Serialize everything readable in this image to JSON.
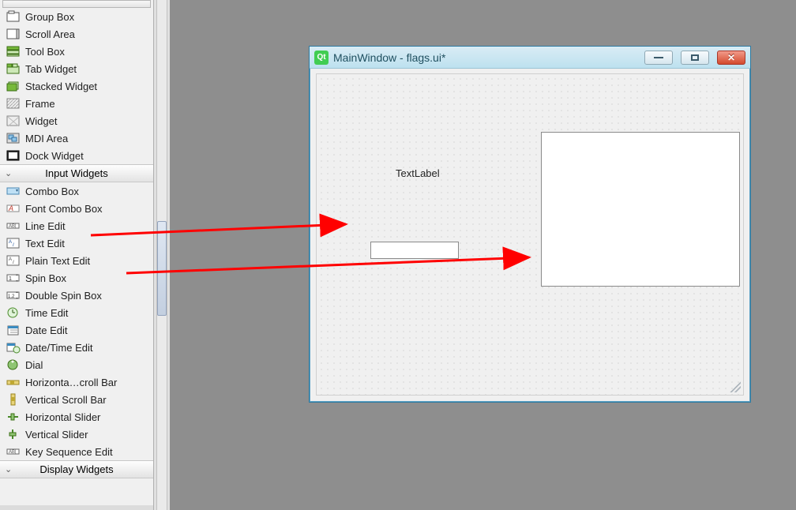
{
  "widget_box": {
    "items_before": [
      {
        "label": "Group Box",
        "icon": "groupbox"
      },
      {
        "label": "Scroll Area",
        "icon": "scrollarea"
      },
      {
        "label": "Tool Box",
        "icon": "toolbox"
      },
      {
        "label": "Tab Widget",
        "icon": "tabwidget"
      },
      {
        "label": "Stacked Widget",
        "icon": "stackedwidget"
      },
      {
        "label": "Frame",
        "icon": "frame"
      },
      {
        "label": "Widget",
        "icon": "widget"
      },
      {
        "label": "MDI Area",
        "icon": "mdiarea"
      },
      {
        "label": "Dock Widget",
        "icon": "dockwidget"
      }
    ],
    "category_input": "Input Widgets",
    "items_input": [
      {
        "label": "Combo Box",
        "icon": "combobox"
      },
      {
        "label": "Font Combo Box",
        "icon": "fontcombobox"
      },
      {
        "label": "Line Edit",
        "icon": "lineedit"
      },
      {
        "label": "Text Edit",
        "icon": "textedit"
      },
      {
        "label": "Plain Text Edit",
        "icon": "plaintextedit"
      },
      {
        "label": "Spin Box",
        "icon": "spinbox"
      },
      {
        "label": "Double Spin Box",
        "icon": "doublespinbox"
      },
      {
        "label": "Time Edit",
        "icon": "timeedit"
      },
      {
        "label": "Date Edit",
        "icon": "dateedit"
      },
      {
        "label": "Date/Time Edit",
        "icon": "datetimeedit"
      },
      {
        "label": "Dial",
        "icon": "dial"
      },
      {
        "label": "Horizonta…croll Bar",
        "icon": "hscrollbar"
      },
      {
        "label": "Vertical Scroll Bar",
        "icon": "vscrollbar"
      },
      {
        "label": "Horizontal Slider",
        "icon": "hslider"
      },
      {
        "label": "Vertical Slider",
        "icon": "vslider"
      },
      {
        "label": "Key Sequence Edit",
        "icon": "keyseq"
      }
    ],
    "category_display": "Display Widgets"
  },
  "designer_window": {
    "title": "MainWindow - flags.ui*",
    "label_text": "TextLabel"
  },
  "annotations": {
    "arrow1_from": "Line Edit",
    "arrow1_to": "QLineEdit field",
    "arrow2_from": "Plain Text Edit",
    "arrow2_to": "QTextEdit area"
  }
}
